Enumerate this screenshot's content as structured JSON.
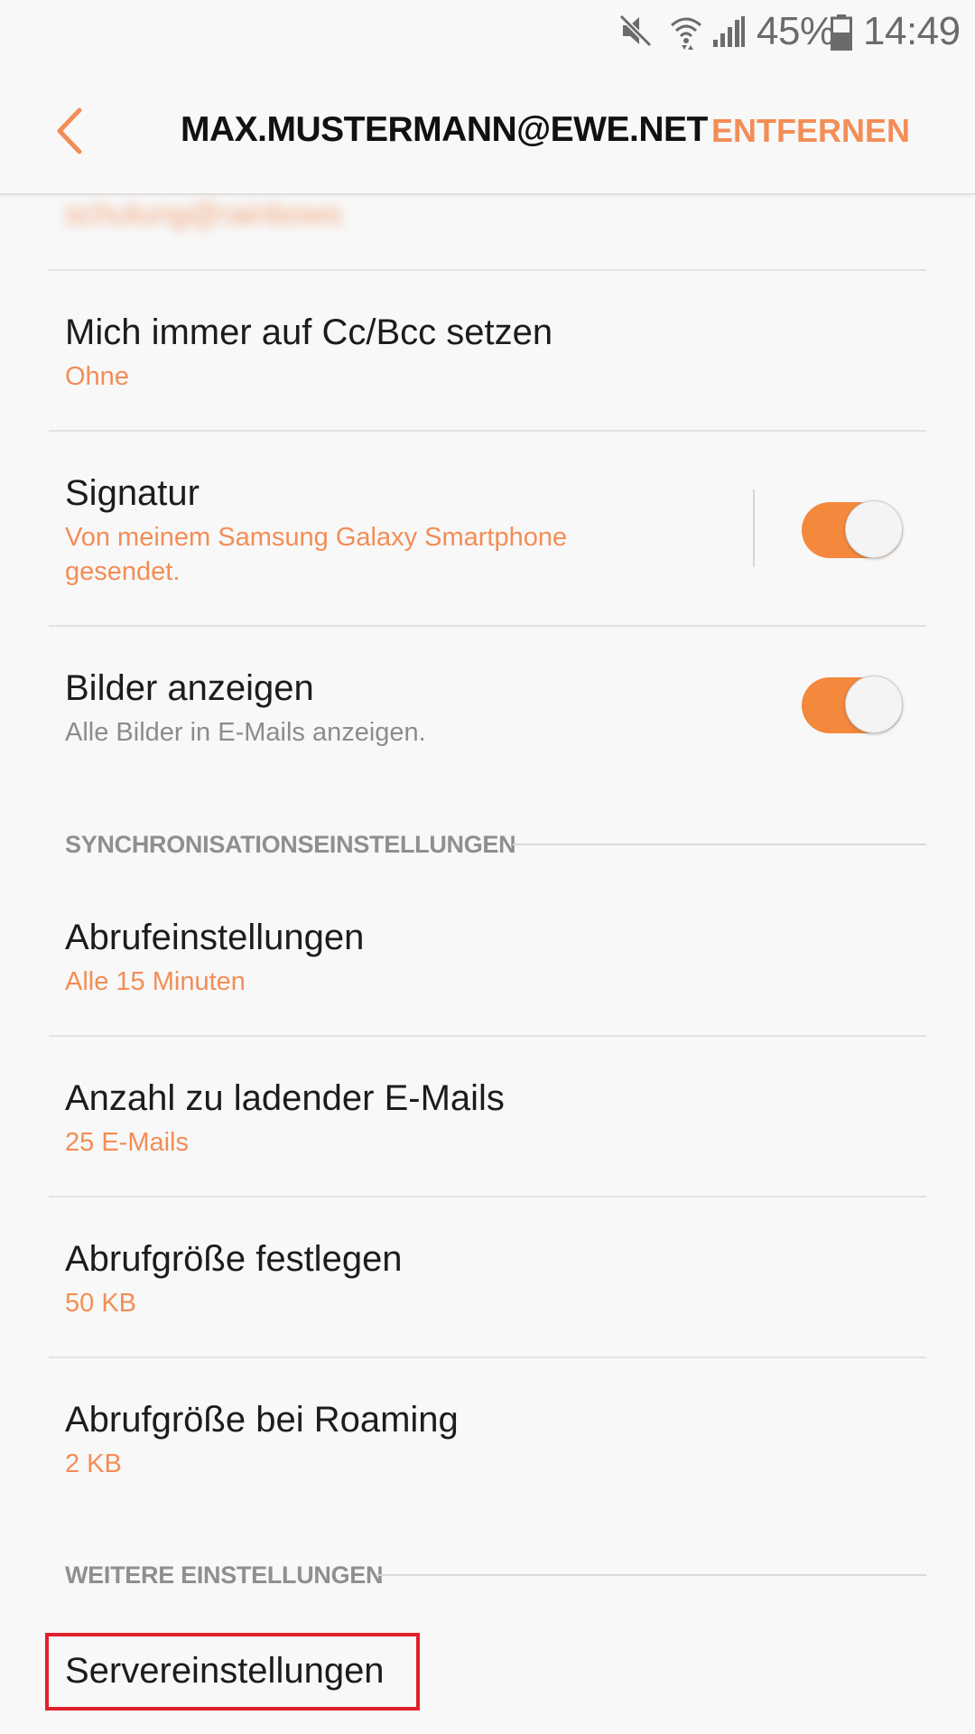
{
  "status_bar": {
    "icons": [
      "mute-icon",
      "wifi-icon",
      "signal-icon",
      "battery-icon"
    ],
    "battery": "45%",
    "time": "14:49"
  },
  "app_bar": {
    "back_icon": "chevron-left-icon",
    "title": "MAX.MUSTERMANN@EWE.NET",
    "action": "ENTFERNEN"
  },
  "obscured_text": "schulung@rainbows",
  "items": [
    {
      "title": "Mich immer auf Cc/Bcc setzen",
      "subtitle": "Ohne"
    },
    {
      "title": "Signatur",
      "subtitle": "Von meinem Samsung Galaxy Smartphone gesendet.",
      "toggle_on": true
    },
    {
      "title": "Bilder anzeigen",
      "subtitle": "Alle Bilder in E-Mails anzeigen.",
      "toggle_on": true
    }
  ],
  "sync_section": {
    "header": "SYNCHRONISATIONSEINSTELLUNGEN",
    "items": [
      {
        "title": "Abrufeinstellungen",
        "subtitle": "Alle 15 Minuten"
      },
      {
        "title": "Anzahl zu ladender E-Mails",
        "subtitle": "25 E-Mails"
      },
      {
        "title": "Abrufgröße festlegen",
        "subtitle": "50 KB"
      },
      {
        "title": "Abrufgröße bei Roaming",
        "subtitle": "2 KB"
      }
    ]
  },
  "more_section": {
    "header": "WEITERE EINSTELLUNGEN",
    "items": [
      {
        "title": "Servereinstellungen"
      }
    ]
  },
  "colors": {
    "accent": "#f38d56",
    "toggle": "#f4883d",
    "highlight": "#e0202b",
    "background": "#f8f8f8"
  }
}
